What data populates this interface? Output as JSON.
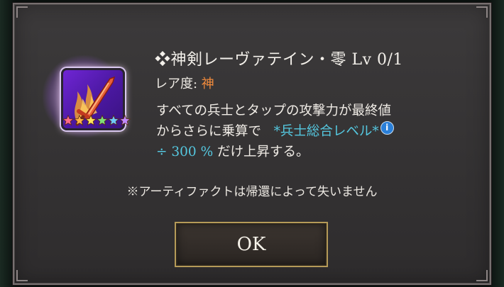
{
  "item": {
    "title": "❖神剣レーヴァテイン・零 Lv 0/1",
    "rarity_label": "レア度: ",
    "rarity_value": "神",
    "stars": 6
  },
  "description": {
    "line1": "すべての兵士とタップの攻撃力が最終値",
    "line2_prefix": "からさらに乗算で",
    "line2_accent": "*兵士総合レベル*",
    "line3_accent": "÷ 300 %",
    "line3_suffix": " だけ上昇する。"
  },
  "note": "※アーティファクトは帰還によって失いません",
  "ok_button": {
    "label": "OK"
  },
  "icons": {
    "info": "info-icon",
    "star": "star-icon",
    "sword": "sword-icon"
  },
  "colors": {
    "accent": "#55c8e0",
    "rarity": "#f08a3c",
    "button_border": "#b59a58",
    "icon_bg": "#6f25d4"
  }
}
